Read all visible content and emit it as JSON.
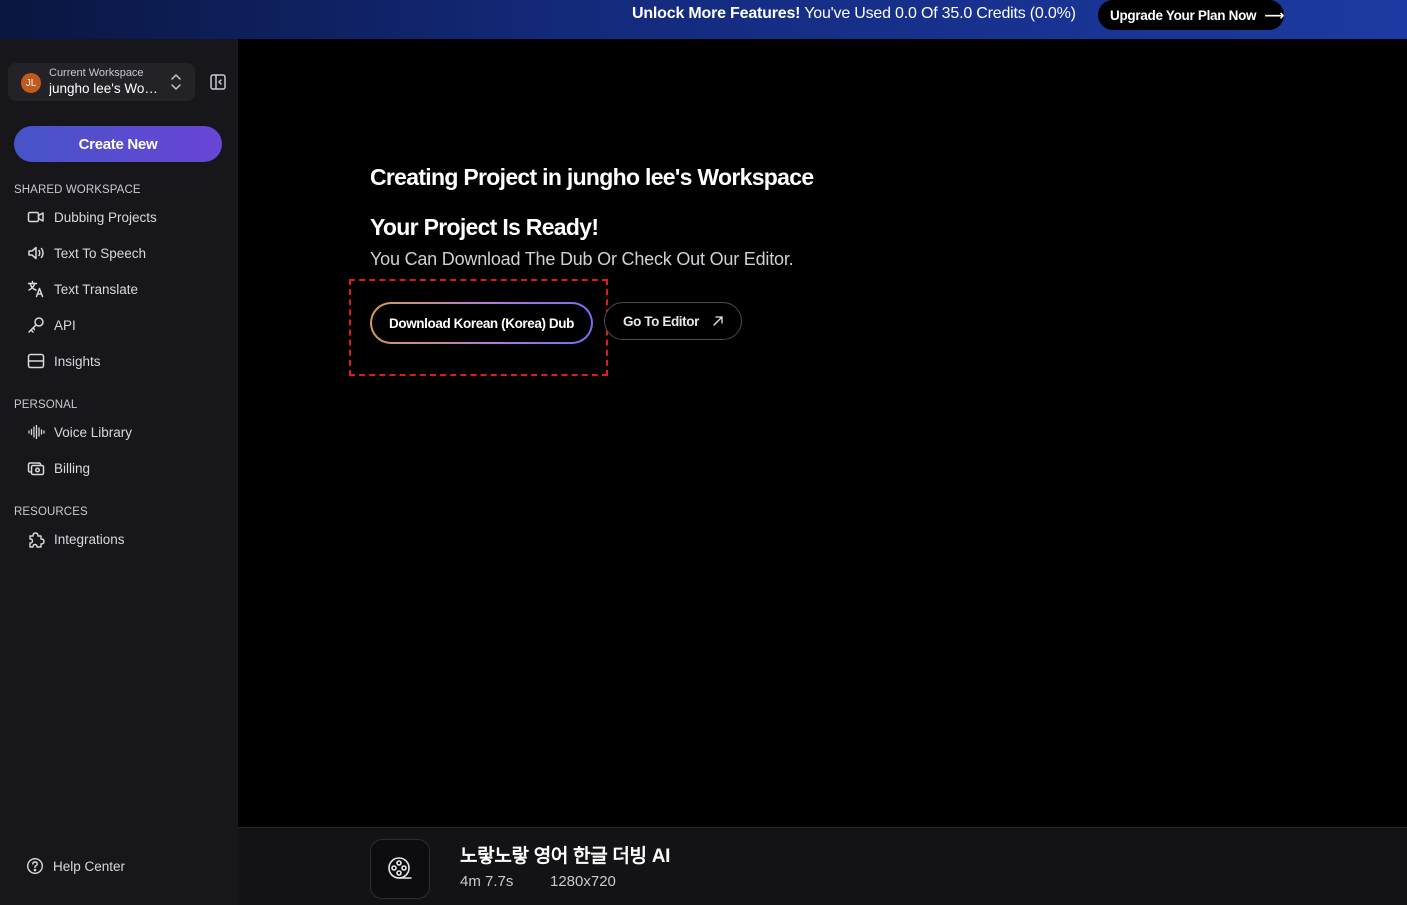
{
  "banner": {
    "bold_text": "Unlock More Features!",
    "usage_text": "You've Used 0.0 Of 35.0 Credits (0.0%)",
    "upgrade_label": "Upgrade Your Plan Now",
    "upgrade_arrow": "⟶"
  },
  "sidebar": {
    "workspace": {
      "avatar_initials": "JL",
      "caption": "Current Workspace",
      "name": "jungho lee's Workspace"
    },
    "create_label": "Create New",
    "sections": {
      "shared": "SHARED WORKSPACE",
      "personal": "PERSONAL",
      "resources": "RESOURCES"
    },
    "items": {
      "dubbing": "Dubbing Projects",
      "tts": "Text To Speech",
      "translate": "Text Translate",
      "api": "API",
      "insights": "Insights",
      "voice_library": "Voice Library",
      "billing": "Billing",
      "integrations": "Integrations"
    },
    "help": "Help Center",
    "icons": {
      "dubbing": "video-camera-icon",
      "tts": "speaker-icon",
      "translate": "translate-icon",
      "api": "key-icon",
      "insights": "insights-icon",
      "voice_library": "waveform-icon",
      "billing": "billing-icon",
      "integrations": "puzzle-icon",
      "help": "question-circle-icon"
    }
  },
  "main": {
    "title": "Creating Project in jungho lee's Workspace",
    "ready_title": "Your Project Is Ready!",
    "ready_subtitle": "You Can Download The Dub Or Check Out Our Editor.",
    "download_label": "Download Korean (Korea) Dub",
    "editor_label": "Go To Editor"
  },
  "bottom": {
    "video_title": "노랗노랗 영어 한글 더빙 AI",
    "duration": "4m 7.7s",
    "resolution": "1280x720"
  },
  "colors": {
    "banner": "#13297a",
    "accent": "#5a4fd3",
    "highlight": "#e01b1b",
    "avatar": "#c2591d"
  }
}
